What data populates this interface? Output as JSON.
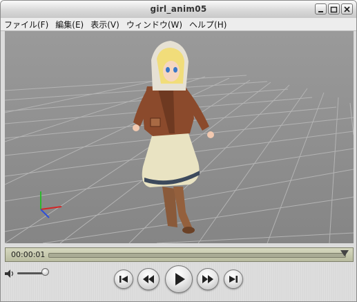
{
  "window": {
    "title": "girl_anim05"
  },
  "menu": [
    "ファイル(F)",
    "編集(E)",
    "表示(V)",
    "ウィンドウ(W)",
    "ヘルプ(H)"
  ],
  "player": {
    "timecode": "00:00:01"
  },
  "icons": {
    "minimize": "minimize-icon",
    "maximize": "maximize-icon",
    "close": "close-icon",
    "volume": "speaker-icon",
    "start": "skip-to-start-icon",
    "rewind": "rewind-icon",
    "play": "play-icon",
    "forward": "fast-forward-icon",
    "end": "skip-to-end-icon"
  },
  "colors": {
    "viewport_bg": "#8f8f8f",
    "timeline_bg": "#c9cbb0"
  }
}
